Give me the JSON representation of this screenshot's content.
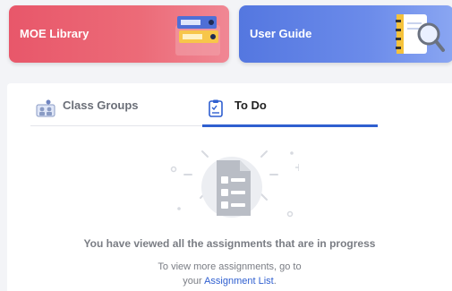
{
  "cards": {
    "moe_library": "MOE Library",
    "user_guide": "User Guide"
  },
  "tabs": [
    {
      "label": "Class Groups",
      "icon": "class-groups-icon",
      "active": false
    },
    {
      "label": "To Do",
      "icon": "todo-clipboard-icon",
      "active": true
    }
  ],
  "empty_state": {
    "title": "You have viewed all the assignments that are in progress",
    "line1": "To view more assignments, go to",
    "line2_prefix": "your ",
    "link": "Assignment List",
    "line2_suffix": "."
  },
  "colors": {
    "moe_card": "#e8576a",
    "guide_card": "#5477e0",
    "accent": "#2f5fd0"
  }
}
